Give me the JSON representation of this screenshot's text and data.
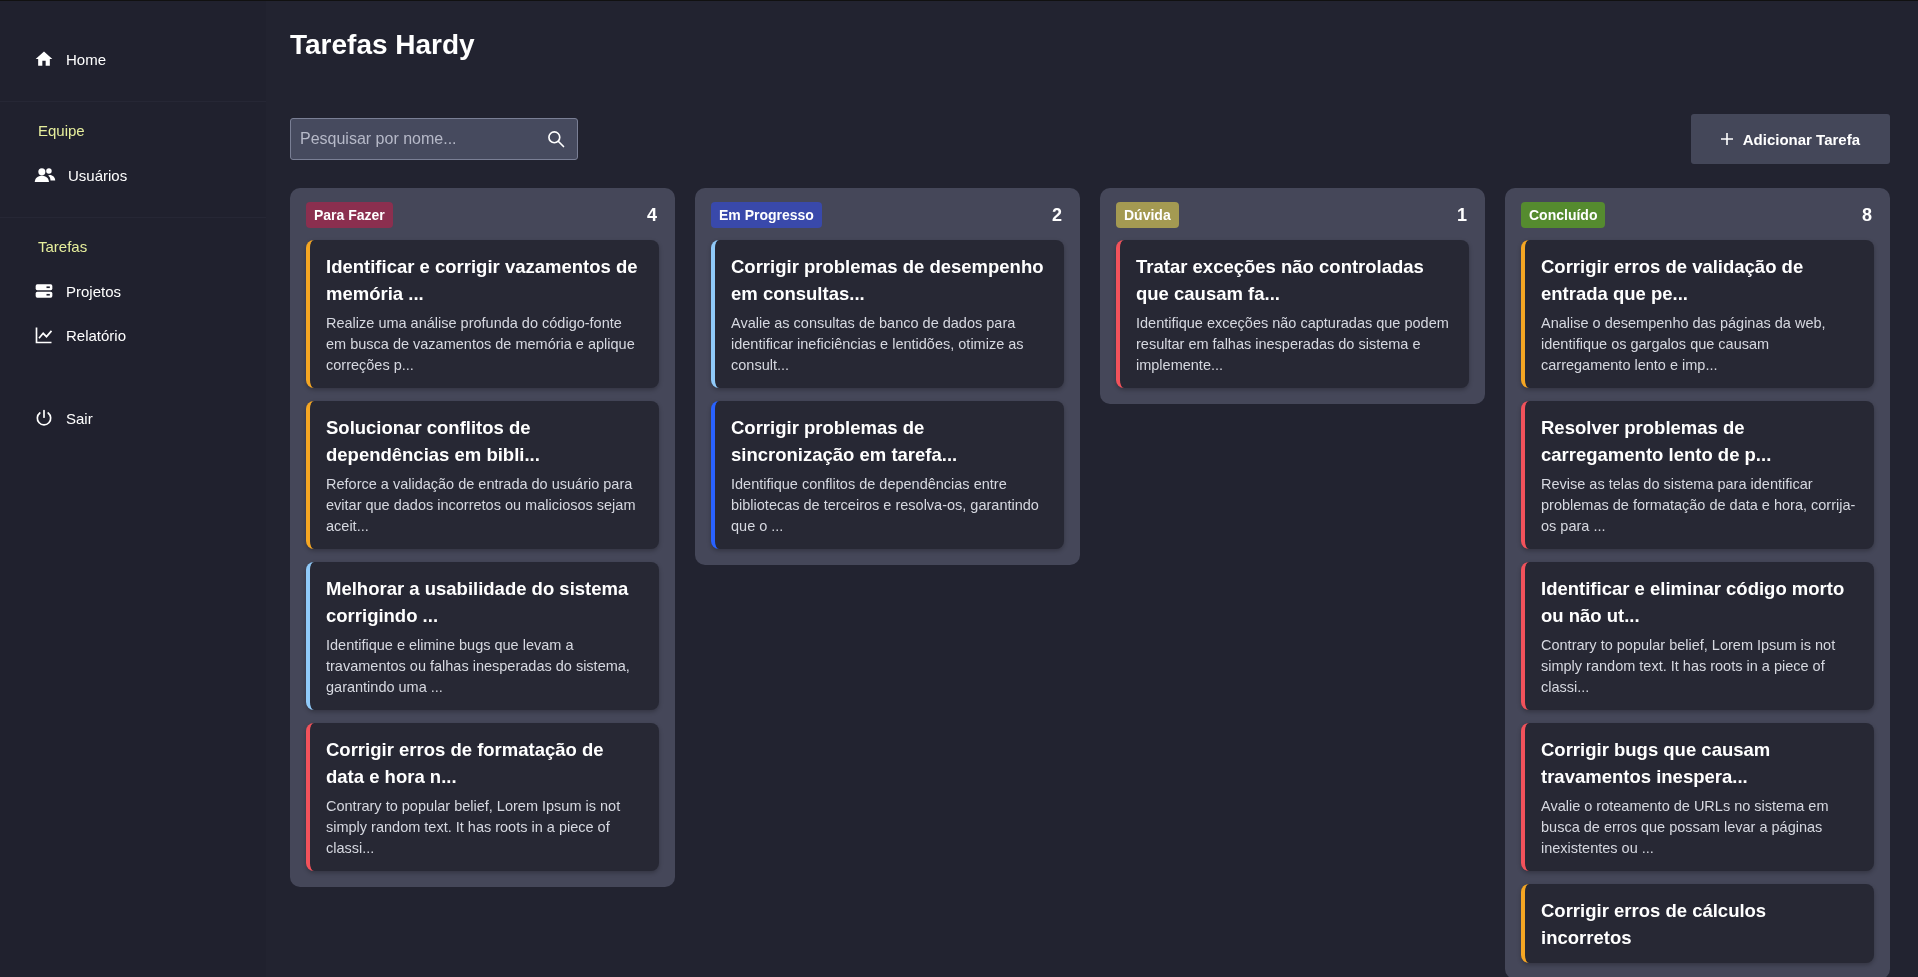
{
  "sidebar": {
    "items": [
      {
        "kind": "link",
        "label": "Home"
      },
      {
        "kind": "section",
        "label": "Equipe"
      },
      {
        "kind": "link",
        "label": "Usuários"
      },
      {
        "kind": "section",
        "label": "Tarefas"
      },
      {
        "kind": "link",
        "label": "Projetos"
      },
      {
        "kind": "link",
        "label": "Relatório"
      },
      {
        "kind": "logout",
        "label": "Sair"
      }
    ]
  },
  "page": {
    "title": "Tarefas Hardy"
  },
  "search": {
    "placeholder": "Pesquisar por nome..."
  },
  "add_button": {
    "label": "Adicionar Tarefa"
  },
  "columns": [
    {
      "label": "Para Fazer",
      "color": "#8b2f4f",
      "count": "4",
      "cards": [
        {
          "color": "#f5a623",
          "title": "Identificar e corrigir vazamentos de memória ...",
          "description": "Realize uma análise profunda do código-fonte em busca de vazamentos de memória e aplique correções p..."
        },
        {
          "color": "#f5a623",
          "title": "Solucionar conflitos de dependências em bibli...",
          "description": "Reforce a validação de entrada do usuário para evitar que dados incorretos ou maliciosos sejam aceit..."
        },
        {
          "color": "#90caf9",
          "title": "Melhorar a usabilidade do sistema corrigindo ...",
          "description": "Identifique e elimine bugs que levam a travamentos ou falhas inesperadas do sistema, garantindo uma ..."
        },
        {
          "color": "#f2525b",
          "title": "Corrigir erros de formatação de data e hora n...",
          "description": "Contrary to popular belief, Lorem Ipsum is not simply random text. It has roots in a piece of classi..."
        }
      ]
    },
    {
      "label": "Em Progresso",
      "color": "#3949ab",
      "count": "2",
      "cards": [
        {
          "color": "#90caf9",
          "title": "Corrigir problemas de desempenho em consultas...",
          "description": "Avalie as consultas de banco de dados para identificar ineficiências e lentidões, otimize as consult..."
        },
        {
          "color": "#2962ff",
          "title": "Corrigir problemas de sincronização em tarefa...",
          "description": "Identifique conflitos de dependências entre bibliotecas de terceiros e resolva-os, garantindo que o ..."
        }
      ]
    },
    {
      "label": "Dúvida",
      "color": "#a49a52",
      "count": "1",
      "cards": [
        {
          "color": "#f2525b",
          "title": "Tratar exceções não controladas que causam fa...",
          "description": "Identifique exceções não capturadas que podem resultar em falhas inesperadas do sistema e implemente..."
        }
      ]
    },
    {
      "label": "Concluído",
      "color": "#558b2f",
      "count": "8",
      "cards": [
        {
          "color": "#f5a623",
          "title": "Corrigir erros de validação de entrada que pe...",
          "description": "Analise o desempenho das páginas da web, identifique os gargalos que causam carregamento lento e imp..."
        },
        {
          "color": "#f2525b",
          "title": "Resolver problemas de carregamento lento de p...",
          "description": "Revise as telas do sistema para identificar problemas de formatação de data e hora, corrija-os para ..."
        },
        {
          "color": "#f2525b",
          "title": "Identificar e eliminar código morto ou não ut...",
          "description": "Contrary to popular belief, Lorem Ipsum is not simply random text. It has roots in a piece of classi..."
        },
        {
          "color": "#f2525b",
          "title": "Corrigir bugs que causam travamentos inespera...",
          "description": "Avalie o roteamento de URLs no sistema em busca de erros que possam levar a páginas inexistentes ou ..."
        },
        {
          "color": "#f5a623",
          "title": "Corrigir erros de cálculos incorretos"
        }
      ]
    }
  ]
}
